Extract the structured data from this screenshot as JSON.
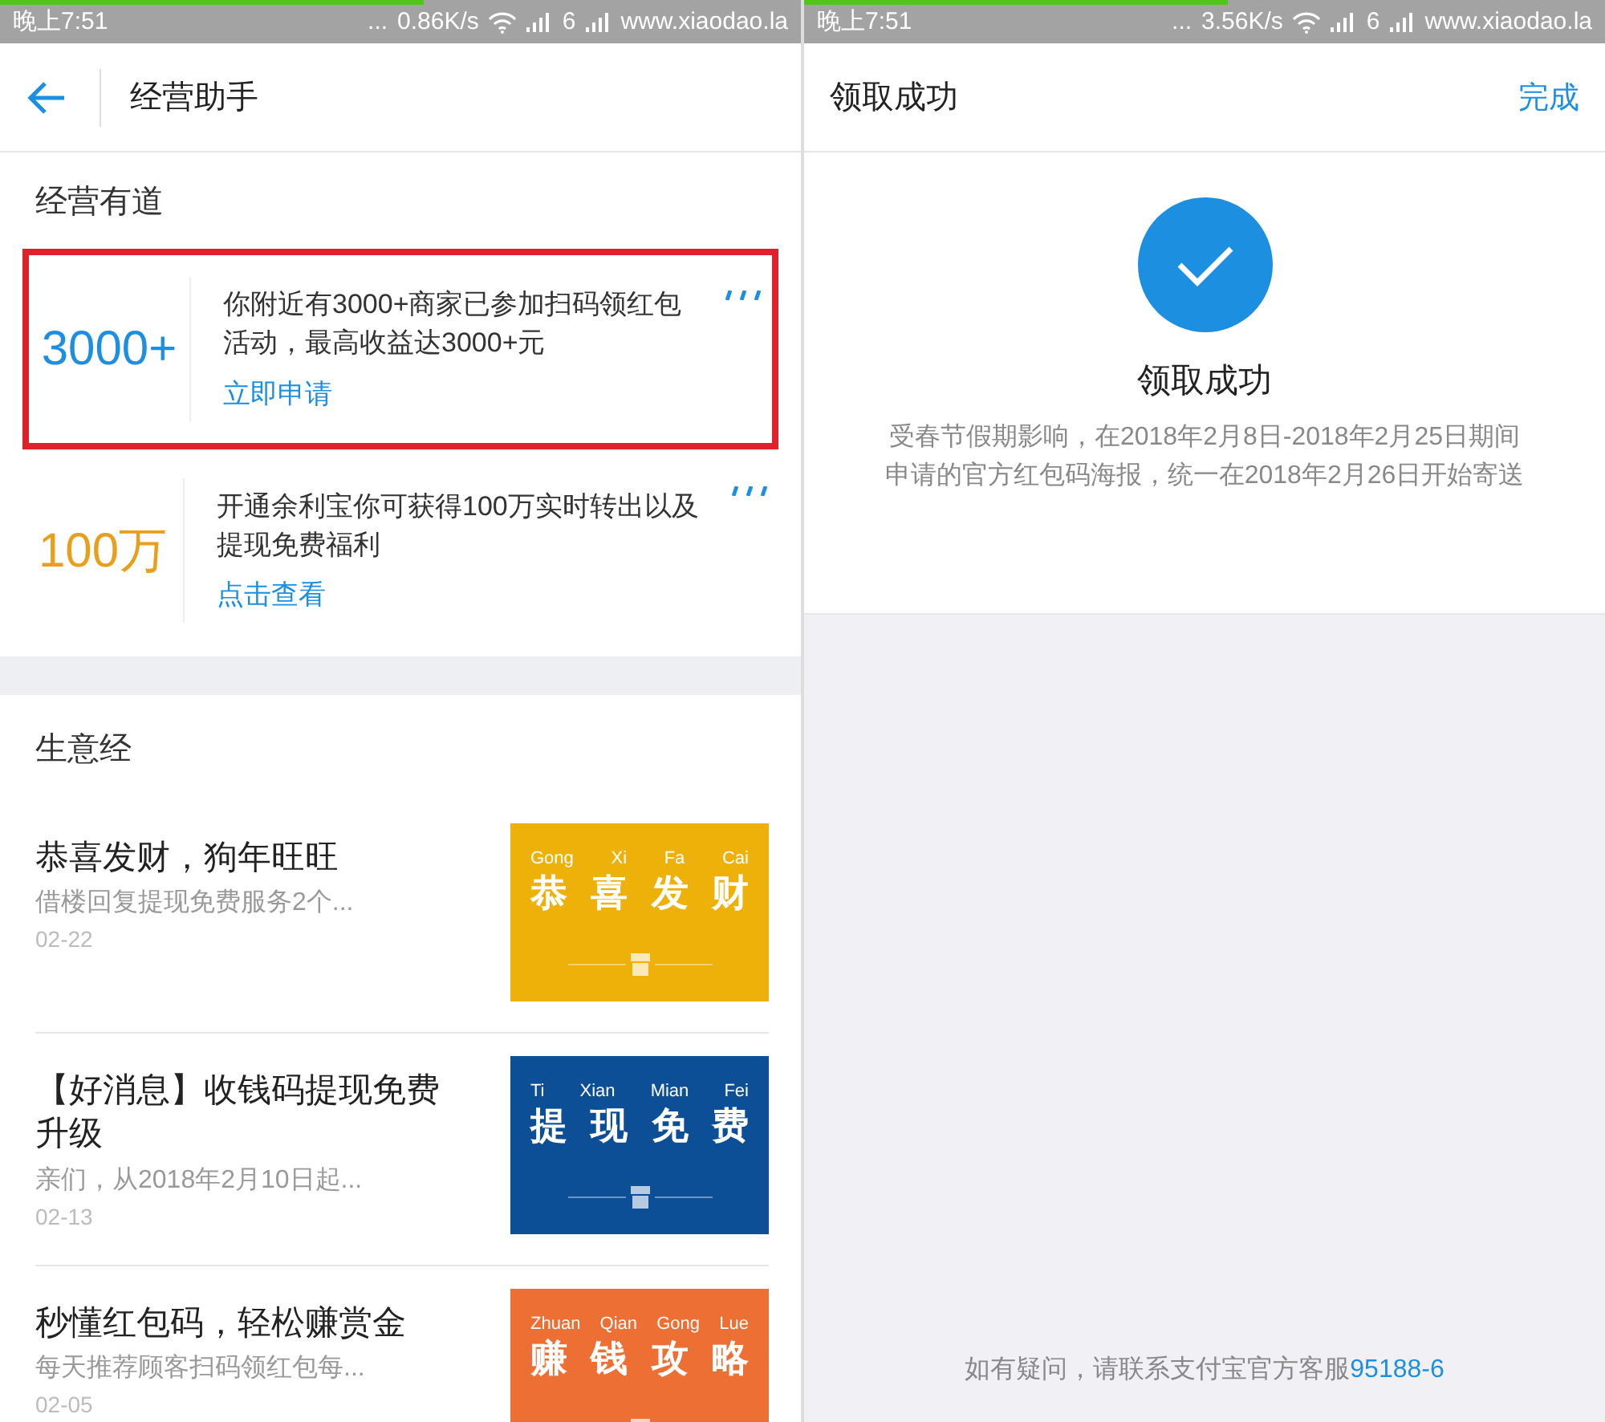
{
  "left_screen": {
    "status_bar": {
      "time": "晚上7:51",
      "more": "...",
      "speed": "0.86K/s",
      "sim": "6",
      "carrier": "www.xiaodao.la"
    },
    "load_progress": {
      "level": 0.53
    },
    "title": "经营助手",
    "section_title": "经营有道",
    "promos": [
      {
        "value": "3000+",
        "color": "#1c8fe0",
        "text": "你附近有3000+商家已参加扫码领红包活动，最高收益达3000+元",
        "link": "立即申请",
        "highlighted": true
      },
      {
        "value": "100万",
        "color": "#e8a01c",
        "text": "开通余利宝你可获得100万实时转出以及提现免费福利",
        "link": "点击查看",
        "highlighted": false
      }
    ],
    "articles_title": "生意经",
    "articles": [
      {
        "title": "恭喜发财，狗年旺旺",
        "summary": "借楼回复提现免费服务2个...",
        "date": "02-22",
        "thumbnail": {
          "color": "#eeb10a",
          "pinyin": [
            "Gong",
            "Xi",
            "Fa",
            "Cai"
          ],
          "chars": [
            "恭",
            "喜",
            "发",
            "财"
          ]
        }
      },
      {
        "title": "【好消息】收钱码提现免费升级",
        "summary": "亲们，从2018年2月10日起...",
        "date": "02-13",
        "thumbnail": {
          "color": "#0c4f97",
          "pinyin": [
            "Ti",
            "Xian",
            "Mian",
            "Fei"
          ],
          "chars": [
            "提",
            "现",
            "免",
            "费"
          ]
        }
      },
      {
        "title": "秒懂红包码，轻松赚赏金",
        "summary": "每天推荐顾客扫码领红包每...",
        "date": "02-05",
        "thumbnail": {
          "color": "#ee6f33",
          "pinyin": [
            "Zhuan",
            "Qian",
            "Gong",
            "Lue"
          ],
          "chars": [
            "赚",
            "钱",
            "攻",
            "略"
          ]
        }
      }
    ]
  },
  "right_screen": {
    "status_bar": {
      "time": "晚上7:51",
      "more": "...",
      "speed": "3.56K/s",
      "sim": "6",
      "carrier": "www.xiaodao.la"
    },
    "load_progress": {
      "level": 0.53
    },
    "title": "领取成功",
    "done": "完成",
    "success_title": "领取成功",
    "message": "受春节假期影响，在2018年2月8日-2018年2月25日期间申请的官方红包码海报，统一在2018年2月26日开始寄送",
    "footer": {
      "text": "如有疑问，请联系支付宝官方客服",
      "link": "95188-6"
    }
  }
}
